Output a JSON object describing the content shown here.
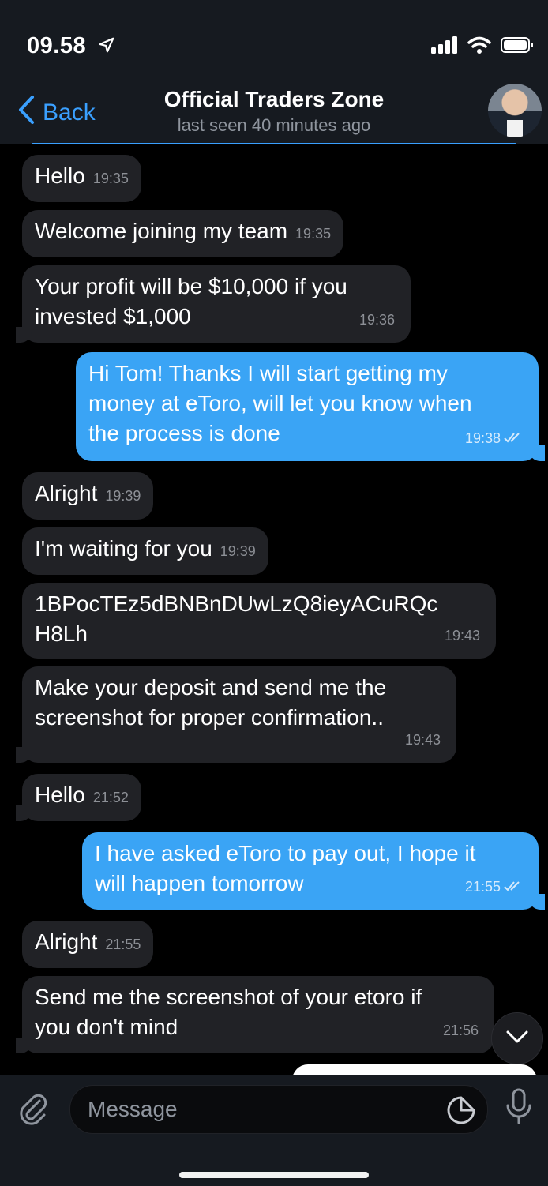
{
  "status_bar": {
    "time": "09.58"
  },
  "header": {
    "back_label": "Back",
    "title": "Official Traders Zone",
    "subtitle": "last seen 40 minutes ago"
  },
  "messages": [
    {
      "dir": "in",
      "text": "Hello",
      "time": "19:35"
    },
    {
      "dir": "in",
      "text": "Welcome joining my team",
      "time": "19:35"
    },
    {
      "dir": "in",
      "text": "Your profit will be $10,000 if you invested $1,000",
      "line1": "Your profit will be $10,000 if you",
      "line2": "invested $1,000",
      "time": "19:36"
    },
    {
      "dir": "out",
      "line1": "Hi Tom! Thanks I will start getting my",
      "line2": "money at eToro, will let you know when",
      "line3": "the process is done",
      "time": "19:38"
    },
    {
      "dir": "in",
      "text": "Alright",
      "time": "19:39"
    },
    {
      "dir": "in",
      "text": "I'm waiting for you",
      "time": "19:39"
    },
    {
      "dir": "in",
      "line1": "1BPocTEz5dBNBnDUwLzQ8ieyACuRQc",
      "line2": "H8Lh",
      "time": "19:43"
    },
    {
      "dir": "in",
      "line1": "Make your deposit and send me the",
      "line2": "screenshot for proper confirmation..",
      "time": "19:43"
    },
    {
      "dir": "in",
      "text": "Hello",
      "time": "21:52"
    },
    {
      "dir": "out",
      "line1": "I have asked eToro to pay out, I hope it",
      "line2": "will happen tomorrow",
      "time": "21:55"
    },
    {
      "dir": "in",
      "text": "Alright",
      "time": "21:55"
    },
    {
      "dir": "in",
      "line1": "Send me the screenshot of your etoro if",
      "line2": "you don't mind",
      "time": "21:56"
    }
  ],
  "composer": {
    "placeholder": "Message"
  },
  "icons": {
    "location": "location-arrow-icon",
    "signal": "signal-icon",
    "wifi": "wifi-icon",
    "battery": "battery-icon",
    "back": "chevron-left-icon",
    "attach": "paperclip-icon",
    "sticker": "sticker-icon",
    "mic": "microphone-icon",
    "scroll": "chevron-down-icon"
  },
  "colors": {
    "accent": "#3aa0ff",
    "outgoing_bubble": "#3aa4f5",
    "incoming_bubble": "#212226"
  }
}
